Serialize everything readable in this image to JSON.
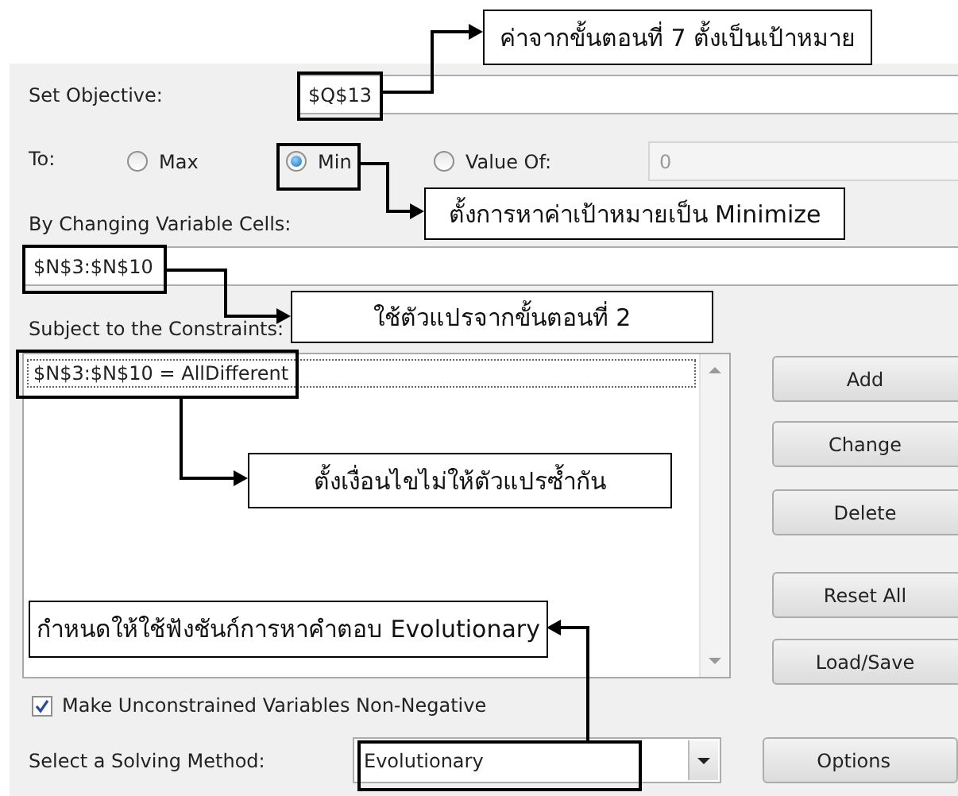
{
  "objective": {
    "label": "Set Objective:",
    "value": "$Q$13"
  },
  "to": {
    "label": "To:",
    "options": [
      {
        "label": "Max",
        "selected": false
      },
      {
        "label": "Min",
        "selected": true
      },
      {
        "label": "Value Of:",
        "selected": false
      }
    ],
    "value_of": {
      "value": "0",
      "disabled": true
    }
  },
  "variables": {
    "label": "By Changing Variable Cells:",
    "value": "$N$3:$N$10"
  },
  "constraints": {
    "label": "Subject to the Constraints:",
    "items": [
      {
        "text": "$N$3:$N$10 = AllDifferent",
        "selected": true
      }
    ]
  },
  "buttons": [
    "Add",
    "Change",
    "Delete",
    "Reset All",
    "Load/Save"
  ],
  "non_negative": {
    "label": "Make Unconstrained Variables Non-Negative",
    "checked": true
  },
  "method": {
    "label": "Select a Solving Method:",
    "value": "Evolutionary"
  },
  "options_button": "Options",
  "annotations": [
    {
      "text": "ค่าจากขั้นตอนที่ 7 ตั้งเป็นเป้าหมาย"
    },
    {
      "text": "ตั้งการหาค่าเป้าหมายเป็น Minimize"
    },
    {
      "text": "ใช้ตัวแปรจากขั้นตอนที่ 2"
    },
    {
      "text": "ตั้งเงื่อนไขไม่ให้ตัวแปรซ้ำกัน"
    },
    {
      "text": "กำหนดให้ใช้ฟังชันก์การหาคำตอบ Evolutionary"
    }
  ]
}
